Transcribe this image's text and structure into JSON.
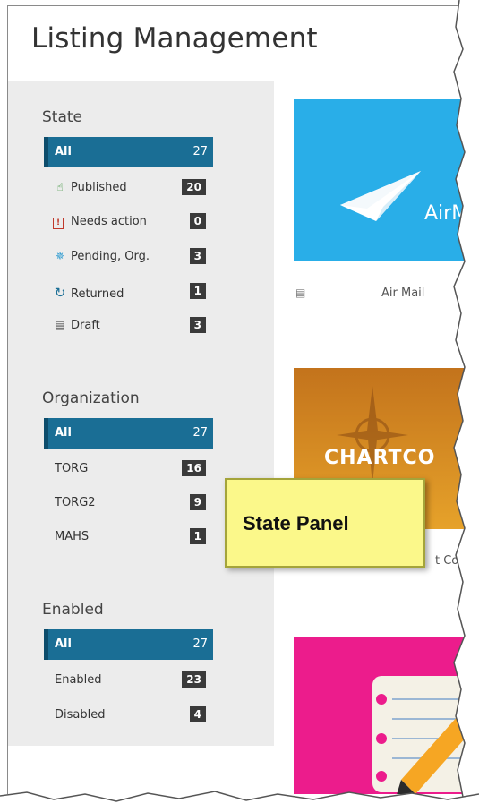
{
  "page_title": "Listing Management",
  "sections": {
    "state": {
      "heading": "State",
      "all": {
        "label": "All",
        "count": "27"
      },
      "items": [
        {
          "icon": "thumbs-up-icon",
          "glyph": "👍",
          "label": "Published",
          "count": "20"
        },
        {
          "icon": "alert-icon",
          "glyph": "!",
          "label": "Needs action",
          "count": "0"
        },
        {
          "icon": "spinner-icon",
          "glyph": "✵",
          "label": "Pending, Org.",
          "count": "3"
        },
        {
          "icon": "refresh-icon",
          "glyph": "↻",
          "label": "Returned",
          "count": "1"
        },
        {
          "icon": "document-icon",
          "glyph": "▤",
          "label": "Draft",
          "count": "3"
        }
      ]
    },
    "organization": {
      "heading": "Organization",
      "all": {
        "label": "All",
        "count": "27"
      },
      "items": [
        {
          "label": "TORG",
          "count": "16"
        },
        {
          "label": "TORG2",
          "count": "9"
        },
        {
          "label": "MAHS",
          "count": "1"
        }
      ]
    },
    "enabled": {
      "heading": "Enabled",
      "all": {
        "label": "All",
        "count": "27"
      },
      "items": [
        {
          "label": "Enabled",
          "count": "23"
        },
        {
          "label": "Disabled",
          "count": "4"
        }
      ]
    }
  },
  "cards": {
    "airmail_tile_text": "AirM",
    "airmail_label": "Air Mail",
    "chart_tile_text": "CHARTCO",
    "chart_label": "t Cou"
  },
  "callout": {
    "text": "State Panel"
  },
  "colors": {
    "active_bg": "#1a6e95",
    "airmail_bg": "#29aee8",
    "pink_bg": "#ec1c8c",
    "chart_bg": "#d88a22",
    "callout_bg": "#fbf88a"
  }
}
